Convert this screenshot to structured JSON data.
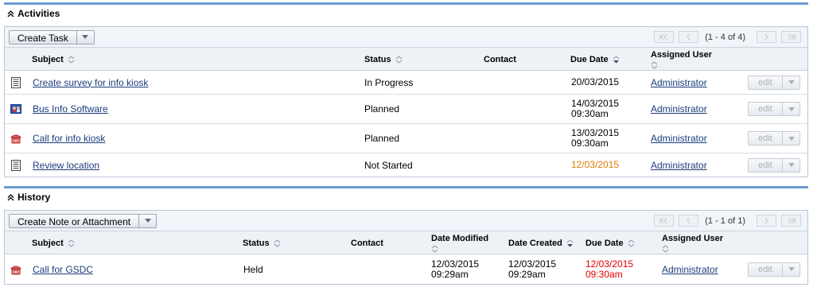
{
  "activities": {
    "title": "Activities",
    "create_button": "Create Task",
    "pager": "(1 - 4 of 4)",
    "columns": {
      "subject": "Subject",
      "status": "Status",
      "contact": "Contact",
      "due_date": "Due Date",
      "assigned_user": "Assigned User"
    },
    "rows": [
      {
        "icon": "task-icon",
        "subject": "Create survey for info kiosk",
        "status": "In Progress",
        "contact": "",
        "due_line1": "20/03/2015",
        "due_line2": "",
        "assigned": "Administrator",
        "edit": "edit"
      },
      {
        "icon": "meeting-icon",
        "subject": "Bus Info Software",
        "status": "Planned",
        "contact": "",
        "due_line1": "14/03/2015",
        "due_line2": "09:30am",
        "assigned": "Administrator",
        "edit": "edit"
      },
      {
        "icon": "call-icon",
        "subject": "Call for info kiosk",
        "status": "Planned",
        "contact": "",
        "due_line1": "13/03/2015",
        "due_line2": "09:30am",
        "assigned": "Administrator",
        "edit": "edit"
      },
      {
        "icon": "task-icon",
        "subject": "Review location",
        "status": "Not Started",
        "contact": "",
        "due_line1": "12/03/2015",
        "due_line2": "",
        "assigned": "Administrator",
        "edit": "edit"
      }
    ]
  },
  "history": {
    "title": "History",
    "create_button": "Create Note or Attachment",
    "pager": "(1 - 1 of 1)",
    "columns": {
      "subject": "Subject",
      "status": "Status",
      "contact": "Contact",
      "date_modified": "Date Modified",
      "date_created": "Date Created",
      "due_date": "Due Date",
      "assigned_user": "Assigned User"
    },
    "rows": [
      {
        "icon": "call-icon",
        "subject": "Call for GSDC",
        "status": "Held",
        "contact": "",
        "modified_line1": "12/03/2015",
        "modified_line2": "09:29am",
        "created_line1": "12/03/2015",
        "created_line2": "09:29am",
        "due_line1": "12/03/2015",
        "due_line2": "09:30am",
        "assigned": "Administrator",
        "edit": "edit"
      }
    ]
  },
  "colors": {
    "section_rule": "#6d9bd0",
    "link": "#1a3d7c",
    "overdue_today": "#e07b00",
    "overdue": "#e00000"
  }
}
